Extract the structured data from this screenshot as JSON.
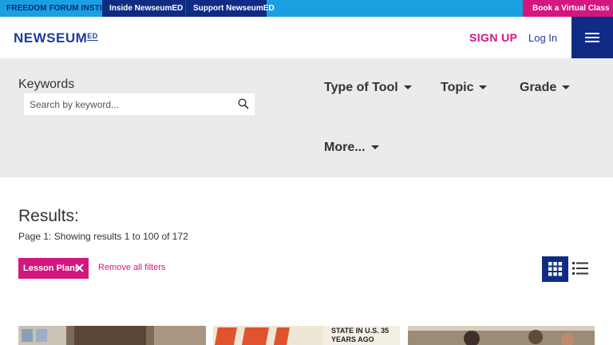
{
  "topbar": {
    "ffi": "FREEDOM FORUM INSTITUTE",
    "inside": "Inside NewseumED",
    "support": "Support NewseumED",
    "book": "Book a Virtual Class"
  },
  "header": {
    "logo_main": "NEWSEUM",
    "logo_ed": "ED",
    "signup": "SIGN UP",
    "login": "Log In"
  },
  "filters": {
    "keywords_label": "Keywords",
    "search_placeholder": "Search by keyword...",
    "type_of_tool": "Type of Tool",
    "topic": "Topic",
    "grade": "Grade",
    "more": "More..."
  },
  "results": {
    "title": "Results:",
    "summary": "Page 1: Showing results 1 to 100 of 172",
    "active_filter": "Lesson Plans",
    "remove_all": "Remove all filters"
  },
  "cards": [
    {
      "caption": "",
      "image": "museum-exhibit-photo"
    },
    {
      "caption": "STATE IN U.S. 35 YEARS AGO",
      "image": "newspaper-headline-photo"
    },
    {
      "caption": "",
      "image": "classroom-students-photo"
    }
  ],
  "colors": {
    "accent_blue": "#0f2b84",
    "accent_magenta": "#d4167f",
    "topbar_blue": "#1aa0e0"
  }
}
